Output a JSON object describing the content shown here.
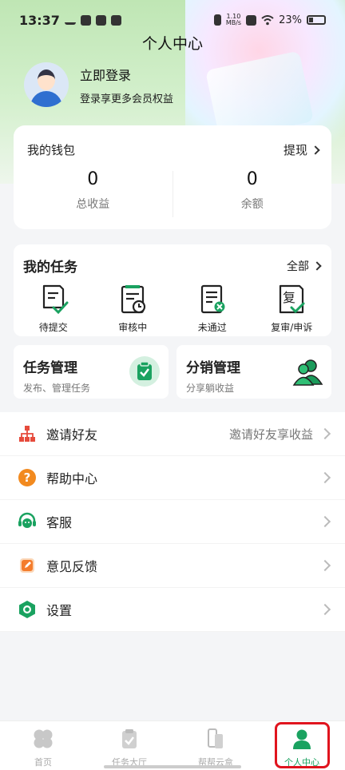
{
  "status": {
    "time": "13:37",
    "speed": "1.10",
    "speed_unit": "MB/s",
    "battery": "23%"
  },
  "header": {
    "title": "个人中心"
  },
  "profile": {
    "login": "立即登录",
    "subtitle": "登录享更多会员权益"
  },
  "wallet": {
    "title": "我的钱包",
    "cash_label": "提现",
    "total_value": "0",
    "total_label": "总收益",
    "balance_value": "0",
    "balance_label": "余额"
  },
  "tasks": {
    "title": "我的任务",
    "all_label": "全部",
    "items": [
      {
        "label": "待提交",
        "icon": "document-check-icon"
      },
      {
        "label": "审核中",
        "icon": "document-clock-icon"
      },
      {
        "label": "未通过",
        "icon": "document-x-icon"
      },
      {
        "label": "复审/申诉",
        "icon": "document-review-icon"
      }
    ]
  },
  "management": {
    "task": {
      "title": "任务管理",
      "subtitle": "发布、管理任务"
    },
    "dist": {
      "title": "分销管理",
      "subtitle": "分享躺收益"
    }
  },
  "menu": [
    {
      "label": "邀请好友",
      "hint": "邀请好友享收益",
      "icon": "org-chart-icon"
    },
    {
      "label": "帮助中心",
      "hint": "",
      "icon": "question-icon"
    },
    {
      "label": "客服",
      "hint": "",
      "icon": "headset-icon"
    },
    {
      "label": "意见反馈",
      "hint": "",
      "icon": "edit-icon"
    },
    {
      "label": "设置",
      "hint": "",
      "icon": "gear-icon"
    }
  ],
  "tabs": [
    {
      "label": "首页",
      "icon": "clover-icon"
    },
    {
      "label": "任务大厅",
      "icon": "clipboard-icon"
    },
    {
      "label": "帮帮云盒",
      "icon": "phone-box-icon"
    },
    {
      "label": "个人中心",
      "icon": "user-icon"
    }
  ],
  "colors": {
    "accent": "#1aa260",
    "highlight": "#e0141e"
  }
}
